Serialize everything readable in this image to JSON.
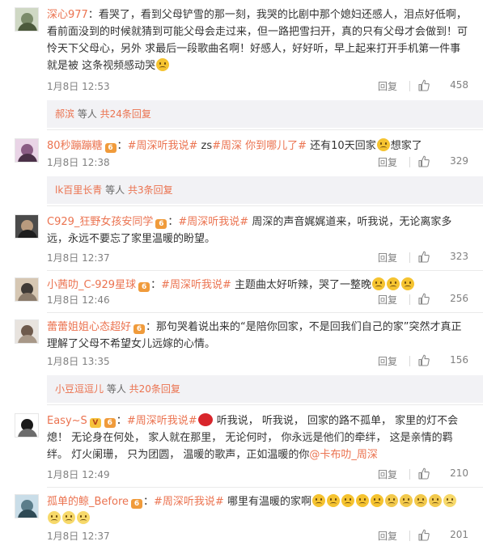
{
  "comments": [
    {
      "user": "深心977",
      "badge": "",
      "text_parts": [
        {
          "type": "sep",
          "text": "："
        },
        {
          "type": "text",
          "text": "看哭了，看到父母铲雪的那一刻，我哭的比剧中那个媳妇还感人，泪点好低啊，看前面没到的时候就猜到可能父母会走过来，但一路把雪扫开，真的只有父母才会做到！可怜天下父母心，另外 求最后一段歌曲名啊！好感人，好好听，早上起来打开手机第一件事就是被 这条视频感动哭"
        },
        {
          "type": "emoji",
          "name": "cry-laugh-emoji"
        }
      ],
      "time": "1月8日 12:53",
      "reply_label": "回复",
      "likes": "458",
      "reply_bar": {
        "name": "郝滨",
        "mid": " 等人 ",
        "more": "共24条回复"
      }
    },
    {
      "user": "80秒蹦蹦糖",
      "badge": "vip",
      "text_parts": [
        {
          "type": "sep",
          "text": "："
        },
        {
          "type": "topic",
          "text": "#周深听我说#"
        },
        {
          "type": "text",
          "text": " zs"
        },
        {
          "type": "topic",
          "text": "#周深 你到哪儿了#"
        },
        {
          "type": "text",
          "text": " 还有10天回家"
        },
        {
          "type": "emoji",
          "name": "cry-emoji"
        },
        {
          "type": "text",
          "text": "想家了"
        }
      ],
      "time": "1月8日 12:38",
      "reply_label": "回复",
      "likes": "329",
      "reply_bar": {
        "name": "lk百里长青",
        "mid": " 等人 ",
        "more": "共3条回复"
      }
    },
    {
      "user": "C929_狂野女孩安同学",
      "badge": "vip",
      "text_parts": [
        {
          "type": "sep",
          "text": "："
        },
        {
          "type": "topic",
          "text": "#周深听我说#"
        },
        {
          "type": "text",
          "text": " 周深的声音娓娓道来，听我说，无论离家多远，永远不要忘了家里温暖的盼望。"
        }
      ],
      "time": "1月8日 12:37",
      "reply_label": "回复",
      "likes": "323",
      "reply_bar": null
    },
    {
      "user": "小茜叻_C-929星球",
      "badge": "vip",
      "text_parts": [
        {
          "type": "sep",
          "text": "："
        },
        {
          "type": "topic",
          "text": "#周深听我说#"
        },
        {
          "type": "text",
          "text": " 主题曲太好听辣，哭了一整晚"
        },
        {
          "type": "emoji",
          "name": "cry-emoji"
        },
        {
          "type": "emoji",
          "name": "cry-emoji"
        },
        {
          "type": "emoji",
          "name": "cry-emoji"
        }
      ],
      "time": "1月8日 12:46",
      "reply_label": "回复",
      "likes": "256",
      "reply_bar": null
    },
    {
      "user": "蕾蕾姐姐心态超好",
      "badge": "vip",
      "text_parts": [
        {
          "type": "sep",
          "text": "："
        },
        {
          "type": "text",
          "text": "那句哭着说出来的“是陪你回家，不是回我们自己的家”突然才真正理解了父母不希望女儿远嫁的心情。"
        }
      ],
      "time": "1月8日 13:35",
      "reply_label": "回复",
      "likes": "156",
      "reply_bar": {
        "name": "小豆逗逗儿",
        "mid": " 等人 ",
        "more": "共20条回复"
      }
    },
    {
      "user": "Easy~S",
      "badge": "v+vip",
      "text_parts": [
        {
          "type": "sep",
          "text": "："
        },
        {
          "type": "topic",
          "text": "#周深听我说#"
        },
        {
          "type": "emoji",
          "name": "heart-emoji"
        },
        {
          "type": "text",
          "text": " 听我说， 听我说， 回家的路不孤单， 家里的灯不会熄！ 无论身在何处， 家人就在那里， 无论何时， 你永远是他们的牵绊， 这是亲情的羁绊。 灯火阑珊， 只为团圆， 温暖的歌声，正如温暖的你"
        },
        {
          "type": "topic",
          "text": "@卡布叻_周深"
        }
      ],
      "time": "1月8日 12:49",
      "reply_label": "回复",
      "likes": "210",
      "reply_bar": null
    },
    {
      "user": "孤单的鲸_Before",
      "badge": "vip",
      "text_parts": [
        {
          "type": "sep",
          "text": "："
        },
        {
          "type": "topic",
          "text": "#周深听我说#"
        },
        {
          "type": "text",
          "text": " 哪里有温暖的家啊"
        },
        {
          "type": "emoji",
          "name": "cry-emoji"
        },
        {
          "type": "emoji",
          "name": "cry-emoji"
        },
        {
          "type": "emoji",
          "name": "cry-emoji"
        },
        {
          "type": "emoji",
          "name": "cry-emoji"
        },
        {
          "type": "emoji",
          "name": "cry-emoji"
        },
        {
          "type": "emoji",
          "name": "sad-emoji"
        },
        {
          "type": "emoji",
          "name": "sad-emoji"
        },
        {
          "type": "emoji",
          "name": "sad-emoji"
        },
        {
          "type": "emoji",
          "name": "sad-emoji"
        },
        {
          "type": "emoji",
          "name": "smile-emoji"
        },
        {
          "type": "emoji",
          "name": "smile-emoji"
        },
        {
          "type": "emoji",
          "name": "smile-emoji"
        },
        {
          "type": "emoji",
          "name": "smile-emoji"
        }
      ],
      "time": "1月8日 12:37",
      "reply_label": "回复",
      "likes": "201",
      "reply_bar": null
    }
  ],
  "colors": {
    "username": "#eb7350",
    "topic": "#eb7350",
    "meta": "#808080",
    "reply_bar_bg": "#f2f2f5",
    "text": "#333333"
  },
  "icons": {
    "like": "thumb-up-icon",
    "badge_vip": "vip-badge-icon",
    "badge_v": "v-badge-icon"
  }
}
